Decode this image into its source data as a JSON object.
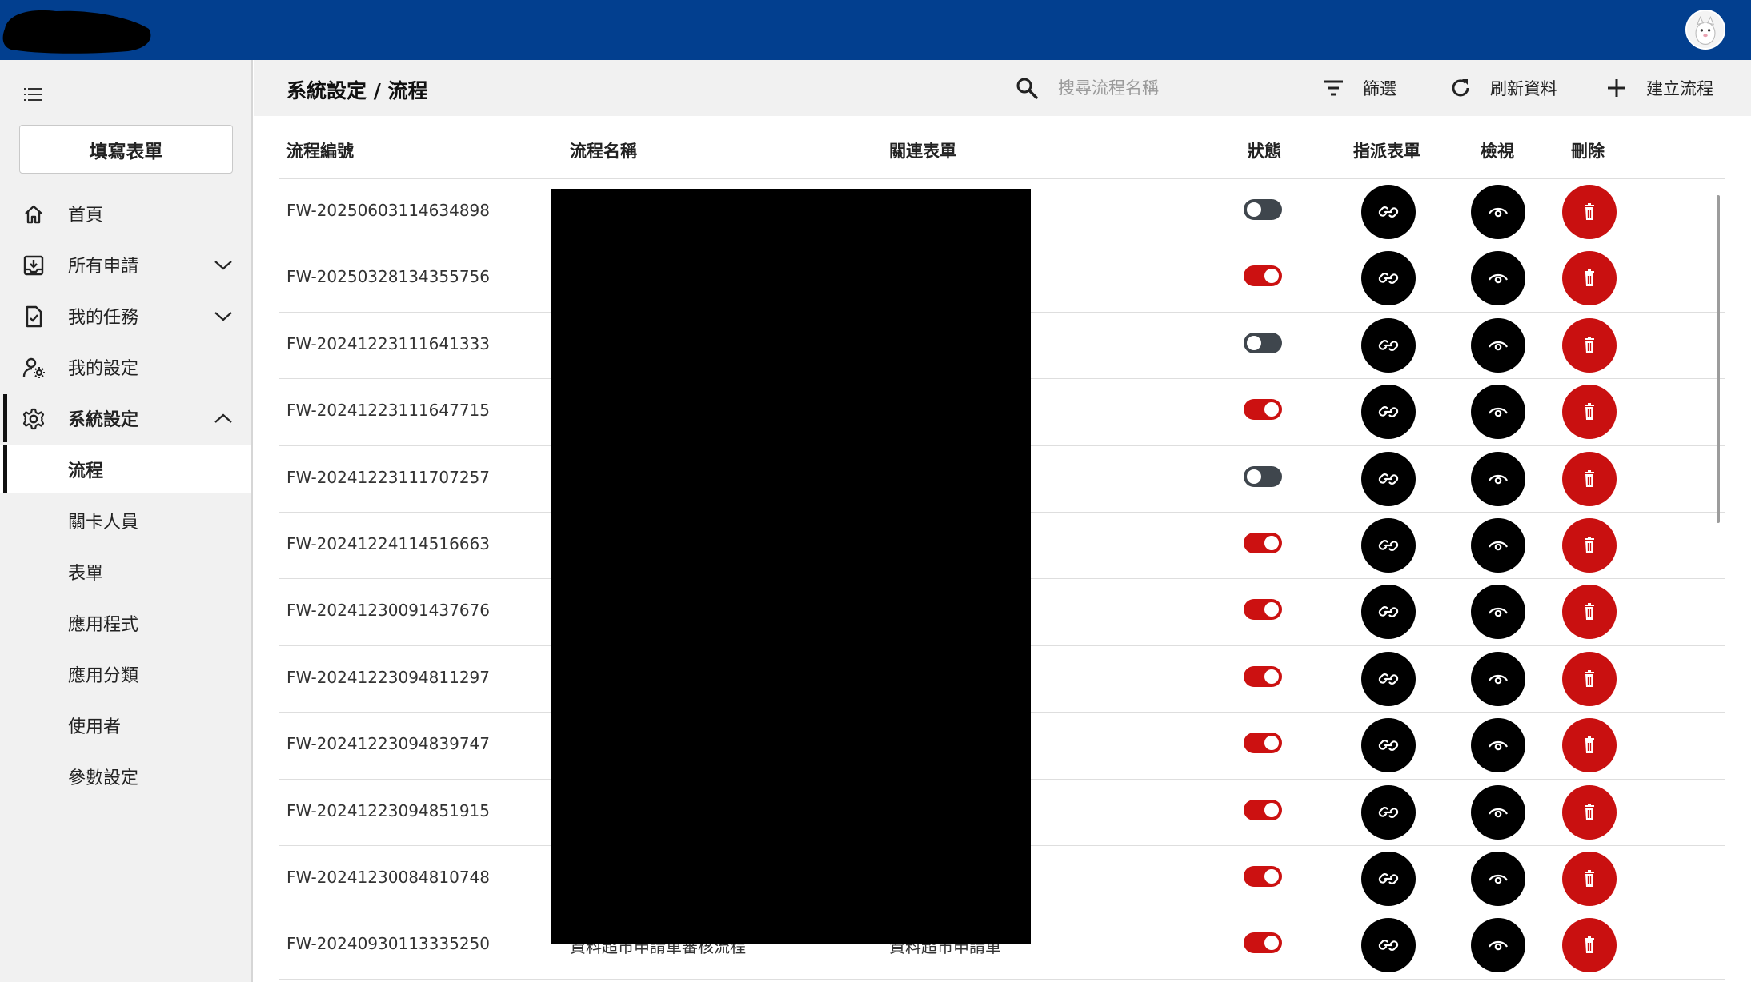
{
  "topbar": {
    "brand_color": "#023f8f",
    "avatar_icon": "user-avatar"
  },
  "sidebar": {
    "menu_icon": "hamburger-menu-icon",
    "fill_form_label": "填寫表單",
    "items": [
      {
        "label": "首頁",
        "icon": "home-icon"
      },
      {
        "label": "所有申請",
        "icon": "inbox-download-icon",
        "expandable": true
      },
      {
        "label": "我的任務",
        "icon": "task-check-icon",
        "expandable": true
      },
      {
        "label": "我的設定",
        "icon": "user-settings-icon"
      },
      {
        "label": "系統設定",
        "icon": "gear-icon",
        "expanded": true
      }
    ],
    "subitems": [
      {
        "label": "流程",
        "active": true
      },
      {
        "label": "關卡人員"
      },
      {
        "label": "表單"
      },
      {
        "label": "應用程式"
      },
      {
        "label": "應用分類"
      },
      {
        "label": "使用者"
      },
      {
        "label": "參數設定"
      }
    ]
  },
  "header": {
    "title": "系統設定 / 流程",
    "search_placeholder": "搜尋流程名稱",
    "filter_label": "篩選",
    "refresh_label": "刷新資料",
    "create_label": "建立流程"
  },
  "table": {
    "columns": {
      "code": "流程編號",
      "name": "流程名稱",
      "form": "關連表單",
      "status": "狀態",
      "assign": "指派表單",
      "view": "檢視",
      "delete": "刪除"
    },
    "rows": [
      {
        "code": "FW-20250603114634898",
        "name": "",
        "form": "",
        "enabled": false
      },
      {
        "code": "FW-20250328134355756",
        "name": "",
        "form": "",
        "enabled": true
      },
      {
        "code": "FW-20241223111641333",
        "name": "",
        "form": "",
        "enabled": false
      },
      {
        "code": "FW-20241223111647715",
        "name": "",
        "form": "",
        "enabled": true
      },
      {
        "code": "FW-20241223111707257",
        "name": "",
        "form": "",
        "enabled": false
      },
      {
        "code": "FW-20241224114516663",
        "name": "",
        "form": "",
        "enabled": true
      },
      {
        "code": "FW-20241230091437676",
        "name": "",
        "form": "",
        "enabled": true
      },
      {
        "code": "FW-20241223094811297",
        "name": "",
        "form": "",
        "enabled": true
      },
      {
        "code": "FW-20241223094839747",
        "name": "",
        "form": "",
        "enabled": true
      },
      {
        "code": "FW-20241223094851915",
        "name": "",
        "form": "",
        "enabled": true
      },
      {
        "code": "FW-20241230084810748",
        "name": "",
        "form": "",
        "enabled": true
      },
      {
        "code": "FW-20240930113335250",
        "name": "資料超市申請單審核流程",
        "form": "資料超市申請單",
        "enabled": true
      }
    ]
  },
  "colors": {
    "toggle_on": "#cc1111",
    "toggle_off": "#3f464d",
    "delete_button": "#c91010",
    "action_button": "#000000"
  }
}
